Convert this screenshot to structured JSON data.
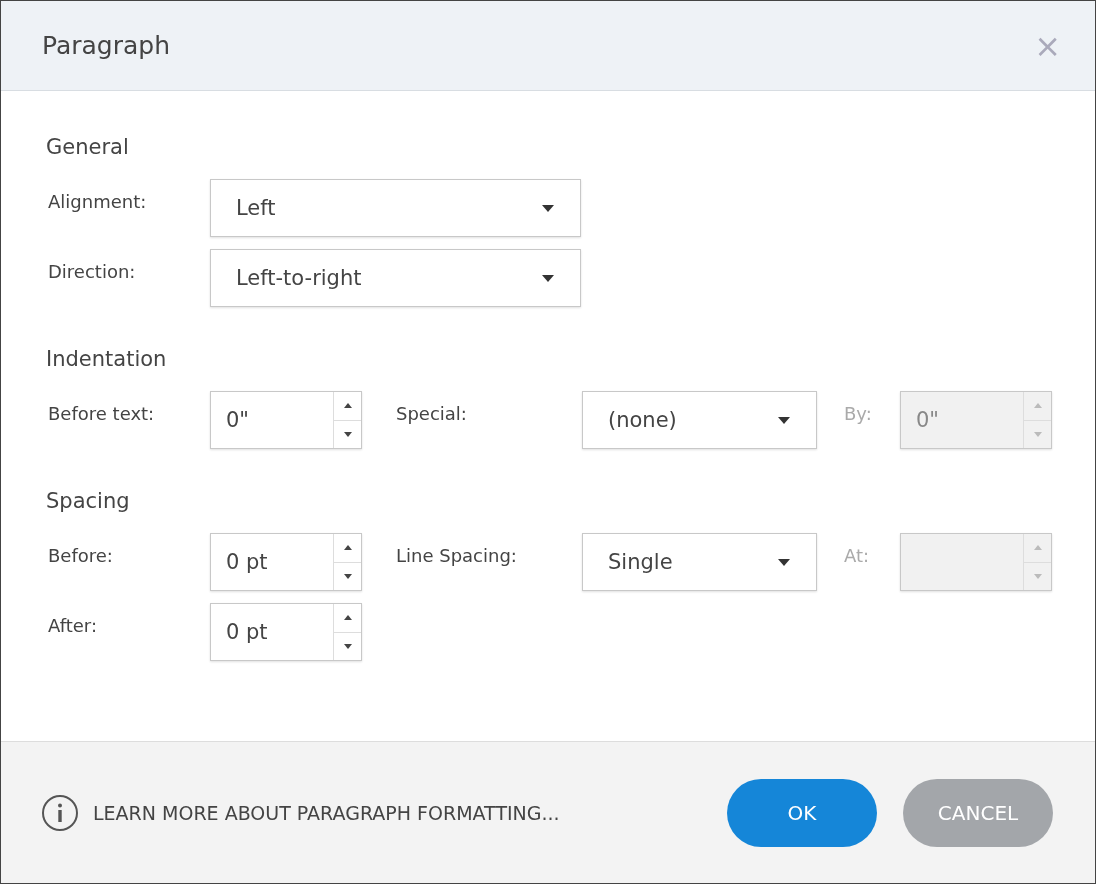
{
  "dialog": {
    "title": "Paragraph",
    "close": "×"
  },
  "sections": [
    {
      "heading": "General",
      "rows": [
        [
          {
            "kind": "select",
            "label": "Alignment:",
            "value": "Left",
            "disabled": false
          }
        ],
        [
          {
            "kind": "select",
            "label": "Direction:",
            "value": "Left-to-right",
            "disabled": false
          }
        ]
      ]
    },
    {
      "heading": "Indentation",
      "rows": [
        [
          {
            "kind": "spinner",
            "label": "Before text:",
            "value": "0\"",
            "disabled": false
          },
          {
            "kind": "select",
            "label": "Special:",
            "value": "(none)",
            "disabled": false
          },
          {
            "kind": "spinner",
            "label": "By:",
            "value": "0\"",
            "disabled": true
          }
        ]
      ]
    },
    {
      "heading": "Spacing",
      "rows": [
        [
          {
            "kind": "spinner",
            "label": "Before:",
            "value": "0 pt",
            "disabled": false
          },
          {
            "kind": "select",
            "label": "Line Spacing:",
            "value": "Single",
            "disabled": false
          },
          {
            "kind": "spinner",
            "label": "At:",
            "disabled": true
          }
        ],
        [
          {
            "kind": "spinner",
            "label": "After:",
            "value": "0 pt",
            "disabled": false
          }
        ]
      ]
    }
  ],
  "footer": {
    "help_link": "LEARN MORE ABOUT PARAGRAPH FORMATTING...",
    "buttons": [
      {
        "label": "OK",
        "kind": "primary"
      },
      {
        "label": "CANCEL",
        "kind": "secondary"
      }
    ]
  }
}
